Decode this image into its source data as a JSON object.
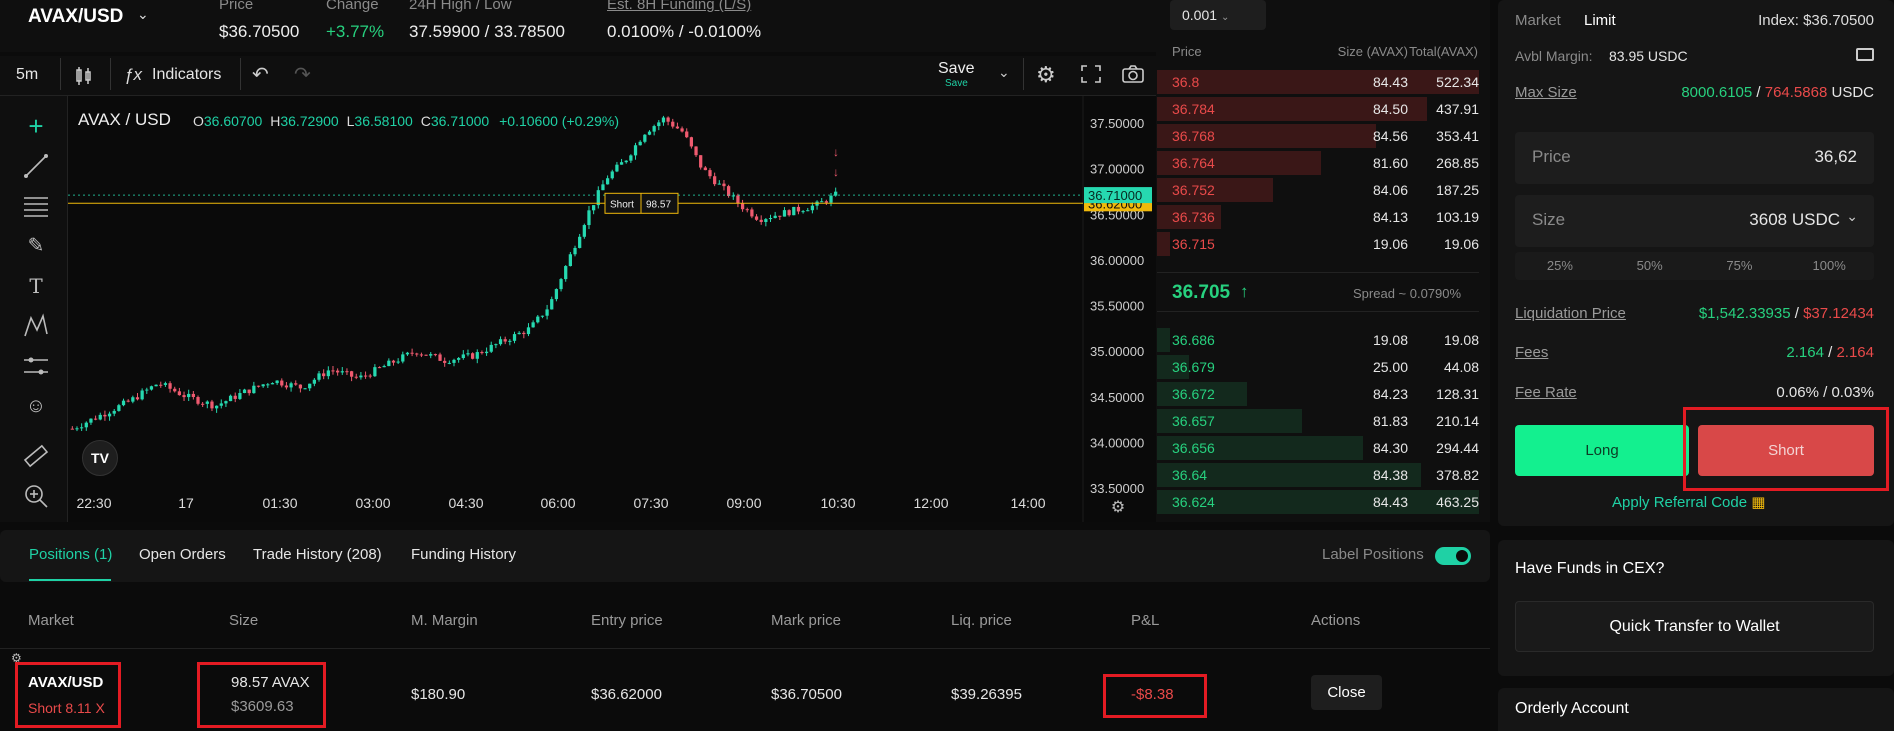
{
  "header": {
    "symbol": "AVAX/USD",
    "price_label": "Price",
    "price_value": "$36.70500",
    "change_label": "Change",
    "change_value": "+3.77%",
    "hilo_label": "24H High / Low",
    "hilo_value": "37.59900 / 33.78500",
    "funding_label": "Est. 8H Funding (L/S)",
    "funding_value": "0.0100% / -0.0100%"
  },
  "chart_toolbar": {
    "interval": "5m",
    "indicators": "Indicators",
    "save": "Save",
    "save_sub": "Save"
  },
  "legend": {
    "symbol": "AVAX / USD",
    "o_label": "O",
    "o": "36.60700",
    "h_label": "H",
    "h": "36.72900",
    "l_label": "L",
    "l": "36.58100",
    "c_label": "C",
    "c": "36.71000",
    "chg": "+0.10600 (+0.29%)"
  },
  "chart_data": {
    "type": "candlestick",
    "y_ticks": [
      "37.50000",
      "37.00000",
      "36.50000",
      "36.00000",
      "35.50000",
      "35.00000",
      "34.50000",
      "34.00000",
      "33.50000"
    ],
    "x_ticks": [
      "22:30",
      "17",
      "01:30",
      "03:00",
      "04:30",
      "06:00",
      "07:30",
      "09:00",
      "10:30",
      "12:00",
      "14:00"
    ],
    "ylim": [
      33.5,
      37.6
    ],
    "last_price": "36.71000",
    "position_line": "36.62000",
    "position_tag": "Short",
    "position_qty": "98.57",
    "colors": {
      "up": "#26d9b0",
      "down": "#ef5a6f",
      "position": "#f0b90b",
      "last": "#26d9b0"
    },
    "path": [
      [
        0,
        34.15
      ],
      [
        6,
        34.3
      ],
      [
        12,
        34.45
      ],
      [
        18,
        34.65
      ],
      [
        24,
        34.5
      ],
      [
        30,
        34.4
      ],
      [
        36,
        34.55
      ],
      [
        42,
        34.68
      ],
      [
        48,
        34.6
      ],
      [
        54,
        34.8
      ],
      [
        60,
        34.7
      ],
      [
        66,
        34.85
      ],
      [
        72,
        35.0
      ],
      [
        78,
        34.9
      ],
      [
        84,
        34.95
      ],
      [
        90,
        35.1
      ],
      [
        96,
        35.25
      ],
      [
        100,
        35.5
      ],
      [
        104,
        36.0
      ],
      [
        108,
        36.5
      ],
      [
        112,
        36.9
      ],
      [
        116,
        37.1
      ],
      [
        120,
        37.4
      ],
      [
        124,
        37.55
      ],
      [
        128,
        37.4
      ],
      [
        132,
        37.0
      ],
      [
        136,
        36.8
      ],
      [
        140,
        36.6
      ],
      [
        144,
        36.45
      ],
      [
        148,
        36.5
      ],
      [
        152,
        36.55
      ],
      [
        156,
        36.6
      ],
      [
        160,
        36.71
      ]
    ]
  },
  "orderbook": {
    "step": "0.001",
    "col_price": "Price",
    "col_size": "Size (AVAX)",
    "col_total": "Total(AVAX)",
    "asks": [
      {
        "price": "36.8",
        "size": "84.43",
        "total": "522.34",
        "depth": 1.0
      },
      {
        "price": "36.784",
        "size": "84.50",
        "total": "437.91",
        "depth": 0.84
      },
      {
        "price": "36.768",
        "size": "84.56",
        "total": "353.41",
        "depth": 0.68
      },
      {
        "price": "36.764",
        "size": "81.60",
        "total": "268.85",
        "depth": 0.51
      },
      {
        "price": "36.752",
        "size": "84.06",
        "total": "187.25",
        "depth": 0.36
      },
      {
        "price": "36.736",
        "size": "84.13",
        "total": "103.19",
        "depth": 0.2
      },
      {
        "price": "36.715",
        "size": "19.06",
        "total": "19.06",
        "depth": 0.04
      }
    ],
    "mid_price": "36.705",
    "mid_arrow": "↑",
    "spread": "Spread ~ 0.0790%",
    "bids": [
      {
        "price": "36.686",
        "size": "19.08",
        "total": "19.08",
        "depth": 0.04
      },
      {
        "price": "36.679",
        "size": "25.00",
        "total": "44.08",
        "depth": 0.1
      },
      {
        "price": "36.672",
        "size": "84.23",
        "total": "128.31",
        "depth": 0.28
      },
      {
        "price": "36.657",
        "size": "81.83",
        "total": "210.14",
        "depth": 0.45
      },
      {
        "price": "36.656",
        "size": "84.30",
        "total": "294.44",
        "depth": 0.64
      },
      {
        "price": "36.64",
        "size": "84.38",
        "total": "378.82",
        "depth": 0.82
      },
      {
        "price": "36.624",
        "size": "84.43",
        "total": "463.25",
        "depth": 1.0
      }
    ]
  },
  "order_form": {
    "tab_market": "Market",
    "tab_limit": "Limit",
    "index": "Index: $36.70500",
    "avbl_label": "Avbl Margin:",
    "avbl_value": "83.95 USDC",
    "max_label": "Max Size",
    "max_long": "8000.6105",
    "max_sep": "/",
    "max_short": "764.5868",
    "max_unit": "USDC",
    "price_label": "Price",
    "price_value": "36,62",
    "size_label": "Size",
    "size_value": "3608 USDC",
    "pcts": [
      "25%",
      "50%",
      "75%",
      "100%"
    ],
    "liq_label": "Liquidation Price",
    "liq_long": "$1,542.33935",
    "liq_sep": "/",
    "liq_short": "$37.12434",
    "fees_label": "Fees",
    "fees_long": "2.164",
    "fees_sep": "/",
    "fees_short": "2.164",
    "feerate_label": "Fee Rate",
    "feerate_value": "0.06% / 0.03%",
    "long_btn": "Long",
    "short_btn": "Short",
    "referral": "Apply Referral Code"
  },
  "cex": {
    "title": "Have Funds in CEX?",
    "button": "Quick Transfer to Wallet"
  },
  "orderly": {
    "title": "Orderly Account"
  },
  "bottom_tabs": {
    "positions": "Positions (1)",
    "open_orders": "Open Orders",
    "trade_history": "Trade History (208)",
    "funding_history": "Funding History",
    "label_positions": "Label Positions"
  },
  "positions_table": {
    "headers": [
      "Market",
      "Size",
      "M. Margin",
      "Entry price",
      "Mark price",
      "Liq. price",
      "P&L",
      "Actions"
    ],
    "row": {
      "market": "AVAX/USD",
      "side": "Short 8.11 X",
      "size": "98.57 AVAX",
      "size_usd": "$3609.63",
      "margin": "$180.90",
      "entry": "$36.62000",
      "mark": "$36.70500",
      "liq": "$39.26395",
      "pnl": "-$8.38",
      "action": "Close"
    }
  }
}
